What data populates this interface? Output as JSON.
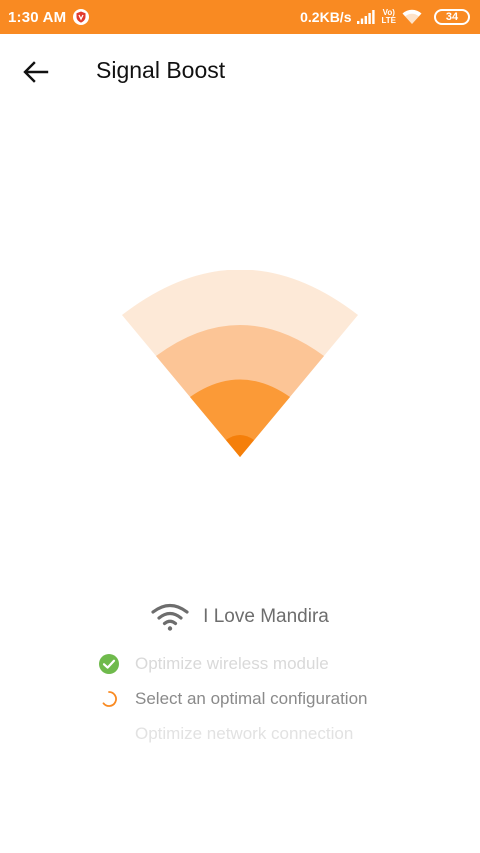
{
  "status_bar": {
    "time": "1:30 AM",
    "notification_icon": "shield-app-icon",
    "net_speed": "0.2KB/s",
    "signal_icon": "cell-signal-icon",
    "network_type_top": "Vo)",
    "network_type_bottom": "LTE",
    "wifi_icon": "wifi-icon",
    "battery_level": "34",
    "background_color": "#f98a22"
  },
  "app_bar": {
    "back_icon": "arrow-left-icon",
    "title": "Signal Boost"
  },
  "graphic": {
    "icon": "wifi-boost-icon",
    "colors": [
      "#fde9d7",
      "#fcc596",
      "#fb9a37",
      "#f57f0a"
    ]
  },
  "network": {
    "icon": "wifi-icon",
    "name": "I Love Mandira"
  },
  "steps": [
    {
      "label": "Optimize wireless module",
      "state": "done",
      "icon": "check-circle-icon",
      "color": "#6fba4c"
    },
    {
      "label": "Select an optimal configuration",
      "state": "active",
      "icon": "spinner-icon",
      "color": "#f98a22"
    },
    {
      "label": "Optimize network connection",
      "state": "pending",
      "icon": ""
    }
  ]
}
